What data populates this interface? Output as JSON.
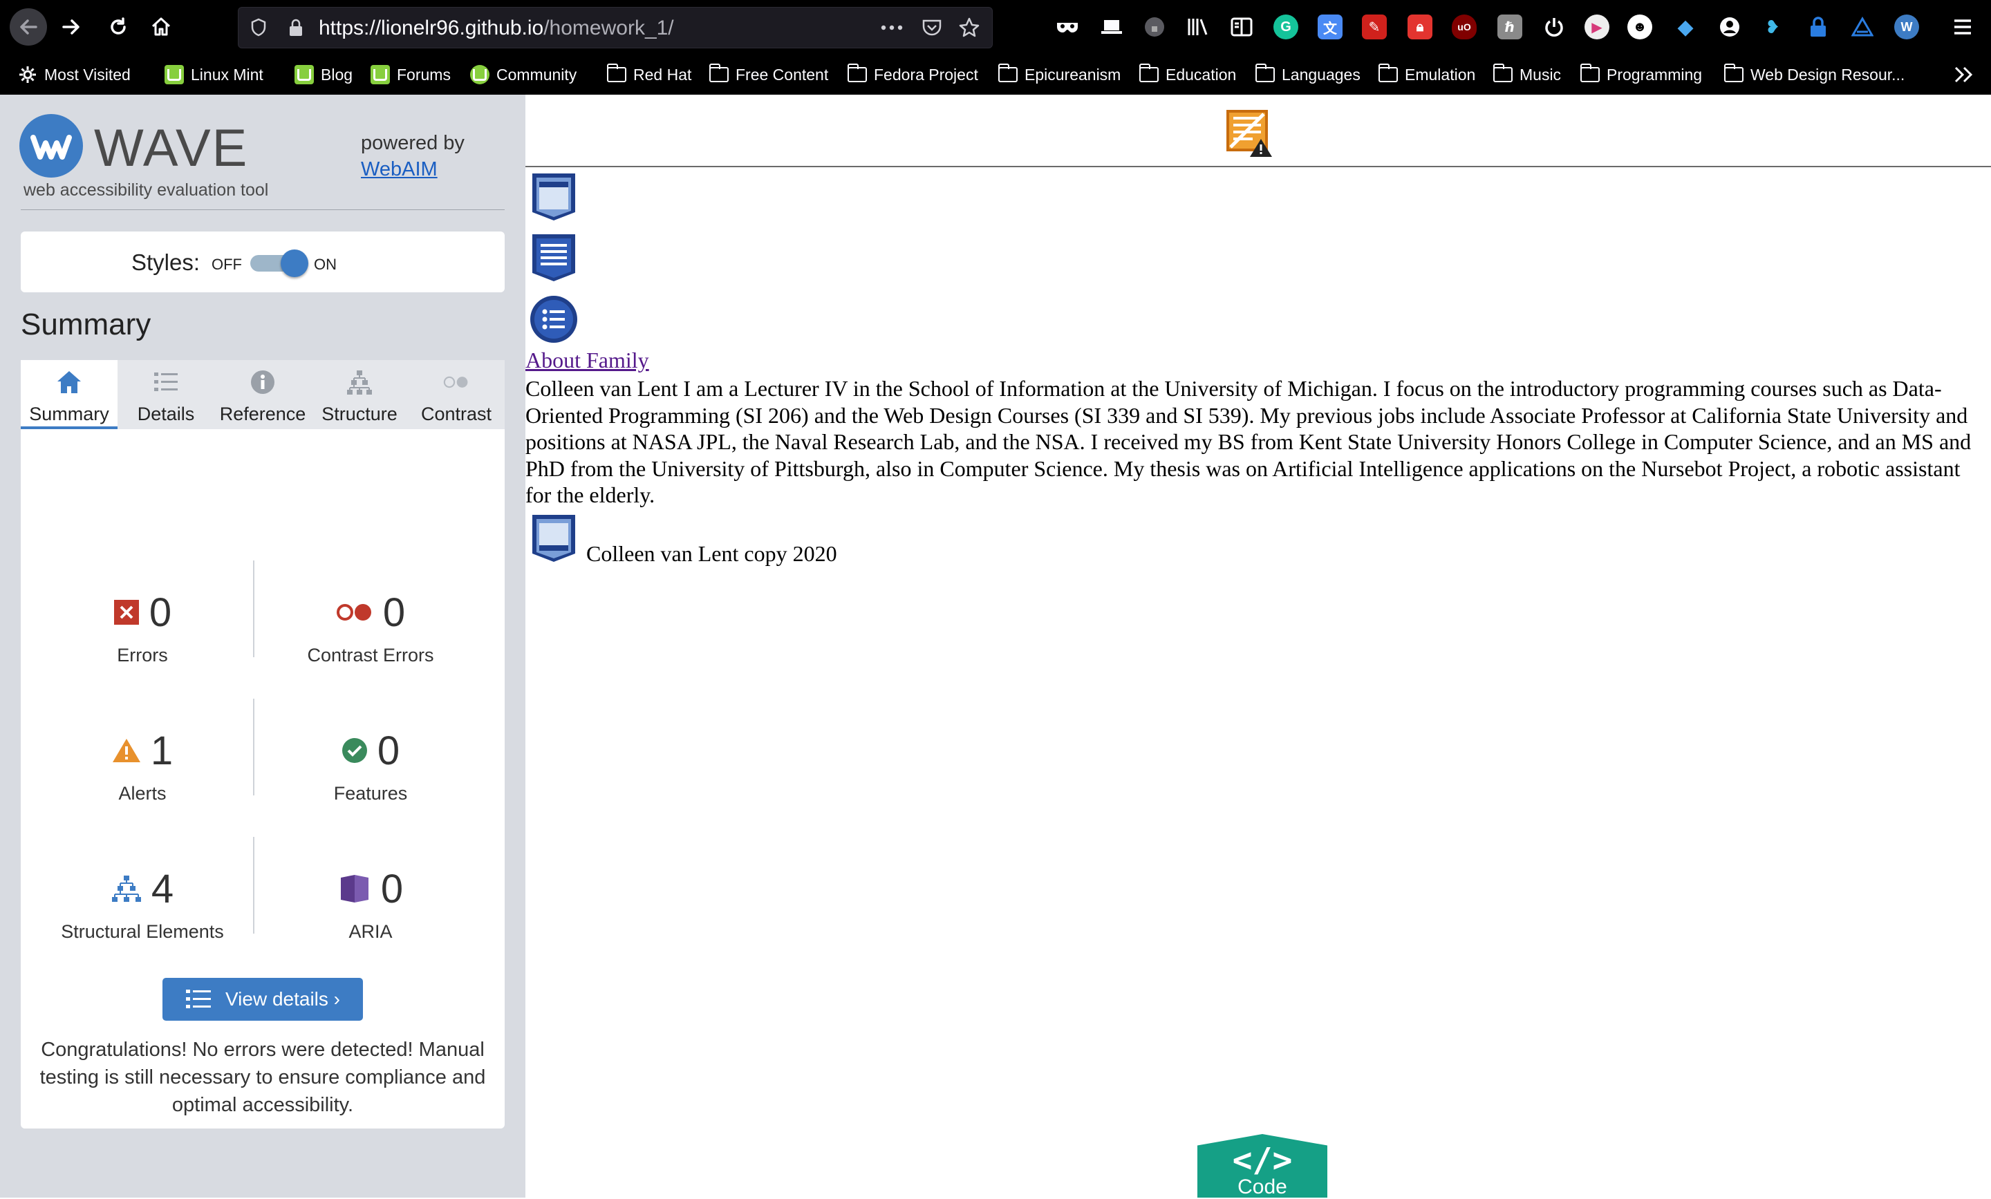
{
  "browser": {
    "url_host": "https://lionelr96.github.io",
    "url_path": "/homework_1/",
    "bookmarks": [
      "Most Visited",
      "Linux Mint",
      "Blog",
      "Forums",
      "Community",
      "Red Hat",
      "Free Content",
      "Fedora Project",
      "Epicureanism",
      "Education",
      "Languages",
      "Emulation",
      "Music",
      "Programming",
      "Web Design Resour..."
    ],
    "extension_icons": [
      "mask-icon",
      "laptop-icon",
      "lock-circle-icon",
      "library-icon",
      "reader-icon",
      "grammarly-icon",
      "translate-icon",
      "wand-icon",
      "lock-icon",
      "ublock-icon",
      "font-icon",
      "power-icon",
      "play-icon",
      "face-icon",
      "diamond-icon",
      "user-icon",
      "bird-icon",
      "padlock-icon",
      "triangle-icon",
      "wave-icon"
    ]
  },
  "wave": {
    "title": "WAVE",
    "tagline": "web accessibility evaluation tool",
    "powered_by": "powered by",
    "webaim": "WebAIM",
    "styles_label": "Styles:",
    "styles_off": "OFF",
    "styles_on": "ON",
    "summary_heading": "Summary",
    "tabs": [
      {
        "label": "Summary",
        "icon": "home-icon"
      },
      {
        "label": "Details",
        "icon": "list-icon"
      },
      {
        "label": "Reference",
        "icon": "info-icon"
      },
      {
        "label": "Structure",
        "icon": "hierarchy-icon"
      },
      {
        "label": "Contrast",
        "icon": "contrast-icon"
      }
    ],
    "stats": {
      "errors": {
        "value": "0",
        "label": "Errors"
      },
      "contrast_errors": {
        "value": "0",
        "label": "Contrast Errors"
      },
      "alerts": {
        "value": "1",
        "label": "Alerts"
      },
      "features": {
        "value": "0",
        "label": "Features"
      },
      "structural": {
        "value": "4",
        "label": "Structural Elements"
      },
      "aria": {
        "value": "0",
        "label": "ARIA"
      }
    },
    "view_details": "View details ›",
    "congrats": "Congratulations! No errors were detected! Manual testing is still necessary to ensure compliance and optimal accessibility."
  },
  "page": {
    "about_link": "About Family",
    "bio": "Colleen van Lent I am a Lecturer IV in the School of Information at the University of Michigan. I focus on the introductory programming courses such as Data-Oriented Programming (SI 206) and the Web Design Courses (SI 339 and SI 539). My previous jobs include Associate Professor at California State University and positions at NASA JPL, the Naval Research Lab, and the NSA. I received my BS from Kent State University Honors College in Computer Science, and an MS and PhD from the University of Pittsburgh, also in Computer Science. My thesis was on Artificial Intelligence applications on the Nursebot Project, a robotic assistant for the elderly.",
    "footer": "Colleen van Lent copy 2020",
    "code_glyph": "</>",
    "code_label": "Code"
  },
  "colors": {
    "wave_blue": "#3d7cc4",
    "error_red": "#c0392b",
    "alert_orange": "#e8912d",
    "feature_green": "#3a8a5c",
    "aria_purple": "#5b3a8c",
    "code_teal": "#15a086",
    "visited_link": "#551a8b"
  }
}
